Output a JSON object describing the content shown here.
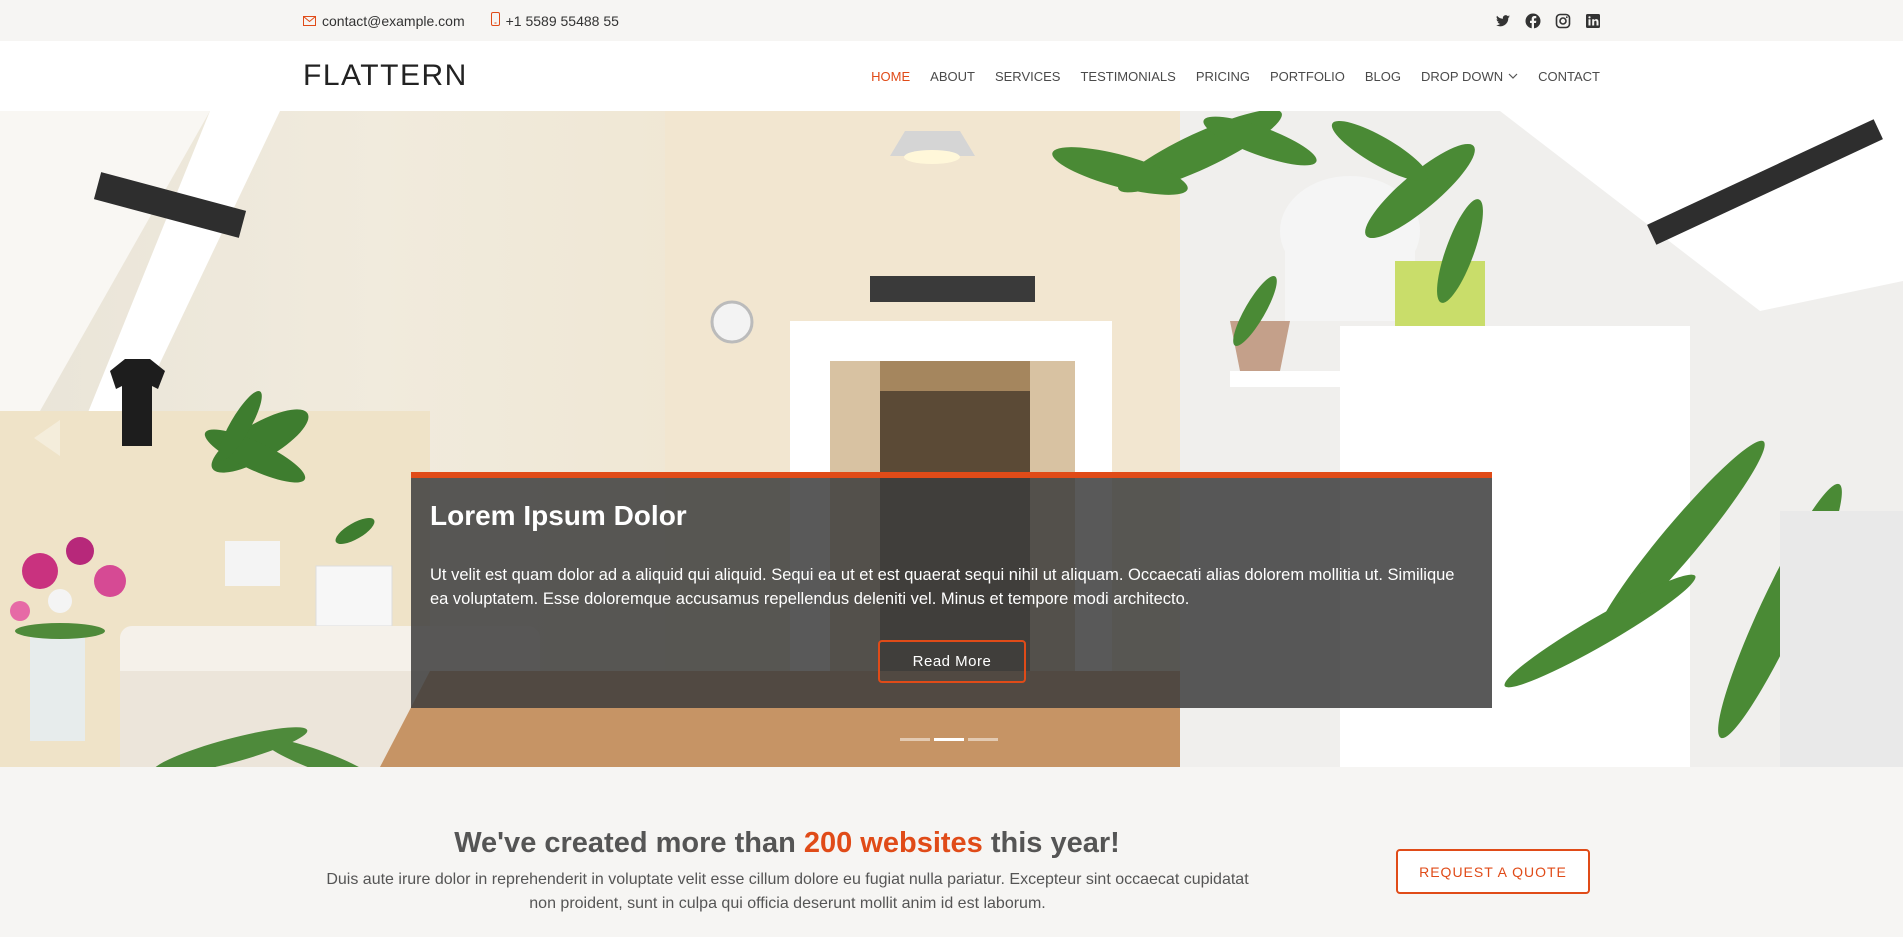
{
  "topbar": {
    "email": "contact@example.com",
    "phone": "+1 5589 55488 55",
    "social": [
      "twitter-icon",
      "facebook-icon",
      "instagram-icon",
      "linkedin-icon"
    ]
  },
  "header": {
    "logo": "FLATTERN",
    "nav": [
      {
        "label": "HOME",
        "active": true
      },
      {
        "label": "ABOUT"
      },
      {
        "label": "SERVICES"
      },
      {
        "label": "TESTIMONIALS"
      },
      {
        "label": "PRICING"
      },
      {
        "label": "PORTFOLIO"
      },
      {
        "label": "BLOG"
      },
      {
        "label": "DROP DOWN",
        "dropdown": true
      },
      {
        "label": "CONTACT"
      }
    ]
  },
  "hero": {
    "title": "Lorem Ipsum Dolor",
    "text": "Ut velit est quam dolor ad a aliquid qui aliquid. Sequi ea ut et est quaerat sequi nihil ut aliquam. Occaecati alias dolorem mollitia ut. Similique ea voluptatem. Esse doloremque accusamus repellendus deleniti vel. Minus et tempore modi architecto.",
    "button": "Read More",
    "slides": 3,
    "active_slide": 2
  },
  "cta": {
    "title_before": "We've created more than ",
    "title_highlight": "200 websites",
    "title_after": " this year!",
    "text": "Duis aute irure dolor in reprehenderit in voluptate velit esse cillum dolore eu fugiat nulla pariatur. Excepteur sint occaecat cupidatat non proident, sunt in culpa qui officia deserunt mollit anim id est laborum.",
    "button": "REQUEST A QUOTE"
  },
  "colors": {
    "accent": "#e04b18",
    "topbar_bg": "#f6f5f3"
  }
}
